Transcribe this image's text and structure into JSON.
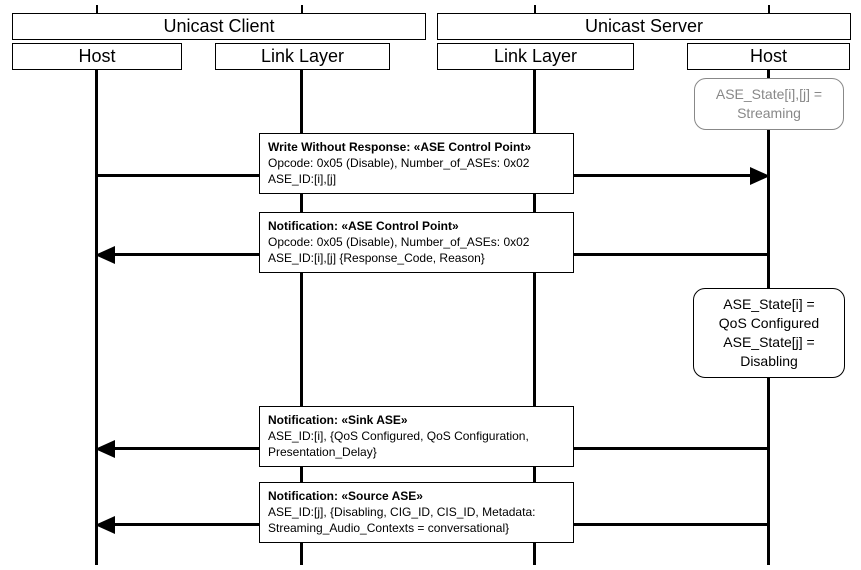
{
  "participants": {
    "client_group": "Unicast Client",
    "server_group": "Unicast Server",
    "client_host": "Host",
    "client_ll": "Link Layer",
    "server_ll": "Link Layer",
    "server_host": "Host"
  },
  "initial_state": {
    "line1": "ASE_State[i],[j] =",
    "line2": "Streaming"
  },
  "msg1": {
    "title": "Write Without Response: «ASE Control Point»",
    "line1": "Opcode: 0x05 (Disable), Number_of_ASEs: 0x02",
    "line2": "ASE_ID:[i],[j]"
  },
  "msg2": {
    "title": "Notification: «ASE Control Point»",
    "line1": "Opcode: 0x05 (Disable), Number_of_ASEs: 0x02",
    "line2": "ASE_ID:[i],[j] {Response_Code, Reason}"
  },
  "state_after": {
    "line1": "ASE_State[i] =",
    "line2": "QoS Configured",
    "line3": "ASE_State[j] =",
    "line4": "Disabling"
  },
  "msg3": {
    "title": "Notification: «Sink ASE»",
    "line1": "ASE_ID:[i], {QoS Configured, QoS Configuration,",
    "line2": "Presentation_Delay}"
  },
  "msg4": {
    "title": "Notification: «Source ASE»",
    "line1": "ASE_ID:[j], {Disabling, CIG_ID, CIS_ID, Metadata:",
    "line2": "Streaming_Audio_Contexts = conversational}"
  }
}
